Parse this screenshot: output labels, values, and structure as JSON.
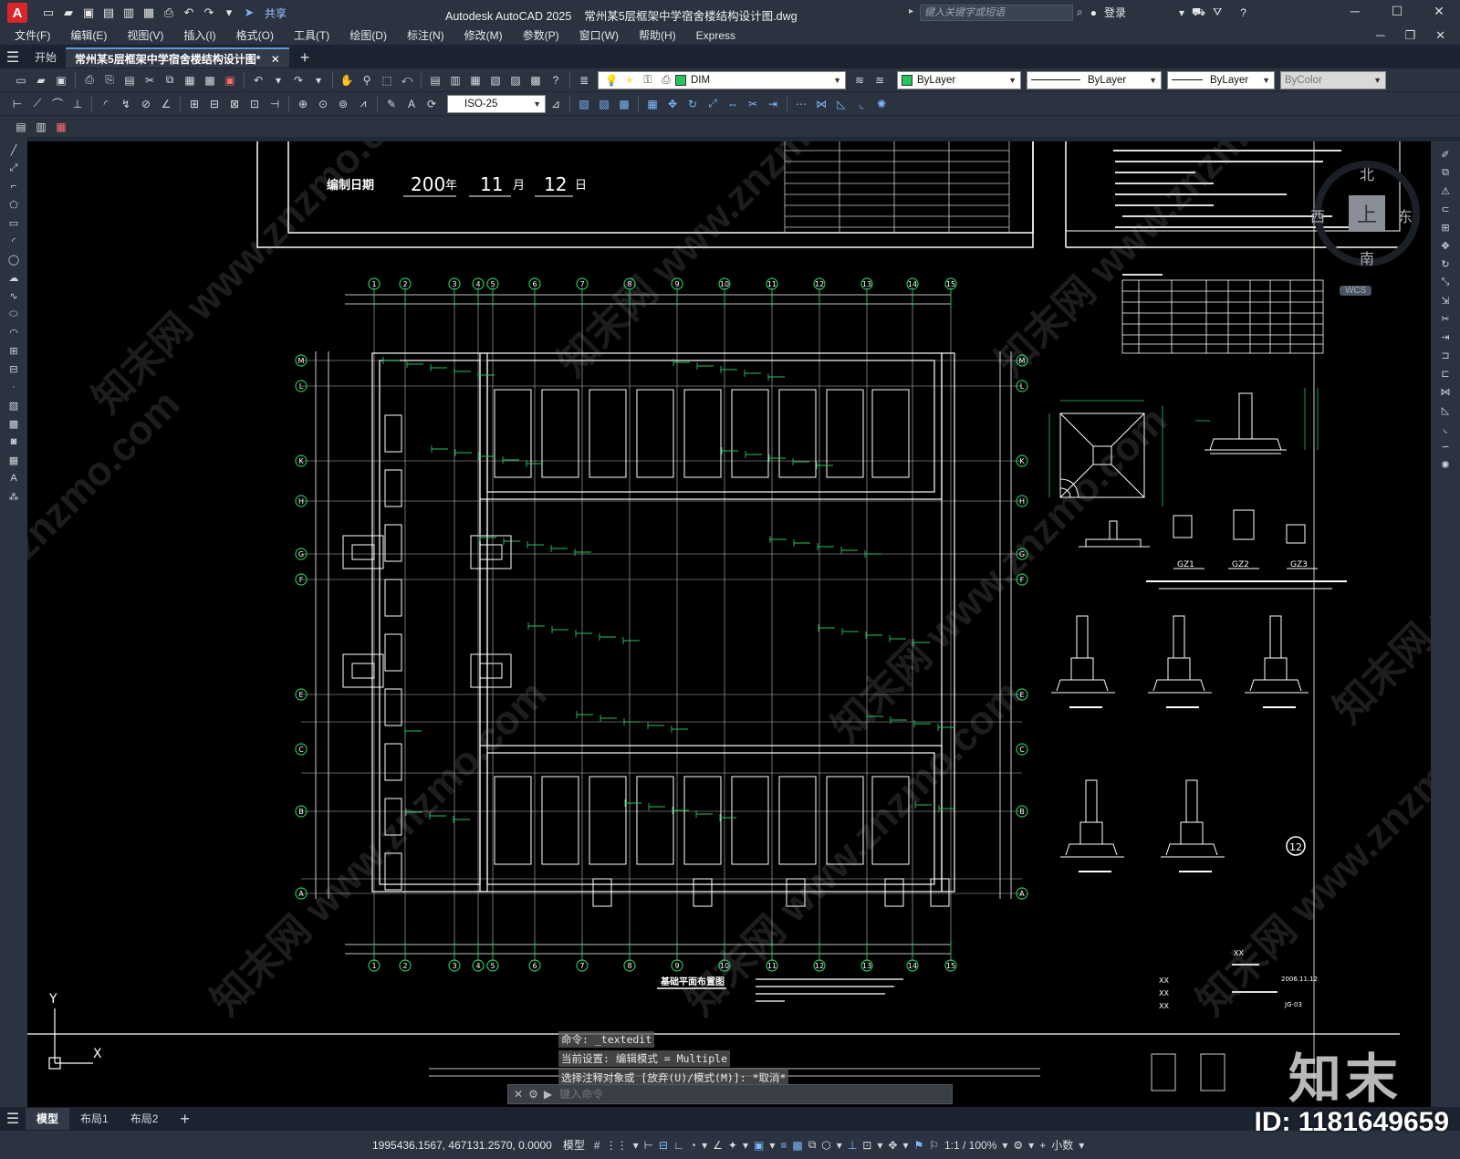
{
  "titlebar": {
    "logo": "A",
    "share": "共享",
    "app": "Autodesk AutoCAD 2025",
    "file": "常州某5层框架中学宿舍楼结构设计图.dwg",
    "search_placeholder": "键入关键字或短语",
    "login": "登录"
  },
  "menu": [
    "文件(F)",
    "编辑(E)",
    "视图(V)",
    "插入(I)",
    "格式(O)",
    "工具(T)",
    "绘图(D)",
    "标注(N)",
    "修改(M)",
    "参数(P)",
    "窗口(W)",
    "帮助(H)",
    "Express"
  ],
  "tabs": {
    "start": "开始",
    "doc": "常州某5层框架中学宿舍楼结构设计图*"
  },
  "properties": {
    "layer": "DIM",
    "layer_color": "#22c55e",
    "color": "ByLayer",
    "linetype": "ByLayer",
    "lineweight": "ByLayer",
    "plotstyle": "ByColor",
    "dimstyle": "ISO-25"
  },
  "drawing": {
    "date_label": "编制日期",
    "year": "200",
    "year_char": "年",
    "month": "11",
    "month_char": "月",
    "day": "12",
    "day_char": "日",
    "plan_title": "基础平面布置图",
    "axis_numbers": [
      "1",
      "2",
      "3",
      "4",
      "5",
      "6",
      "7",
      "8",
      "9",
      "10",
      "11",
      "12",
      "13",
      "14",
      "15"
    ],
    "axis_letters": [
      "M",
      "L",
      "K",
      "H",
      "G",
      "F",
      "E",
      "C",
      "B",
      "A"
    ],
    "section_labels": [
      "GZ1",
      "GZ2",
      "GZ3"
    ],
    "detail_marker": "12",
    "xx": "XX",
    "date_small": "2006.11.12",
    "sheet_no": "JG-03"
  },
  "viewcube": {
    "north": "北",
    "south": "南",
    "east": "东",
    "west": "西",
    "face": "上",
    "wcs": "WCS"
  },
  "command": {
    "lines": [
      "命令: _textedit",
      "当前设置: 编辑模式 = Multiple",
      "选择注释对象或 [放弃(U)/模式(M)]: *取消*"
    ],
    "placeholder": "键入命令"
  },
  "layout_tabs": [
    "模型",
    "布局1",
    "布局2"
  ],
  "status": {
    "coords": "1995436.1567, 467131.2570, 0.0000",
    "model": "模型",
    "scale": "1:1 / 100%",
    "units": "小数"
  },
  "watermark": {
    "logo": "知末",
    "id": "ID: 1181649659",
    "site": "znzmo.com",
    "cn": "知末网 www.znzmo.com"
  }
}
